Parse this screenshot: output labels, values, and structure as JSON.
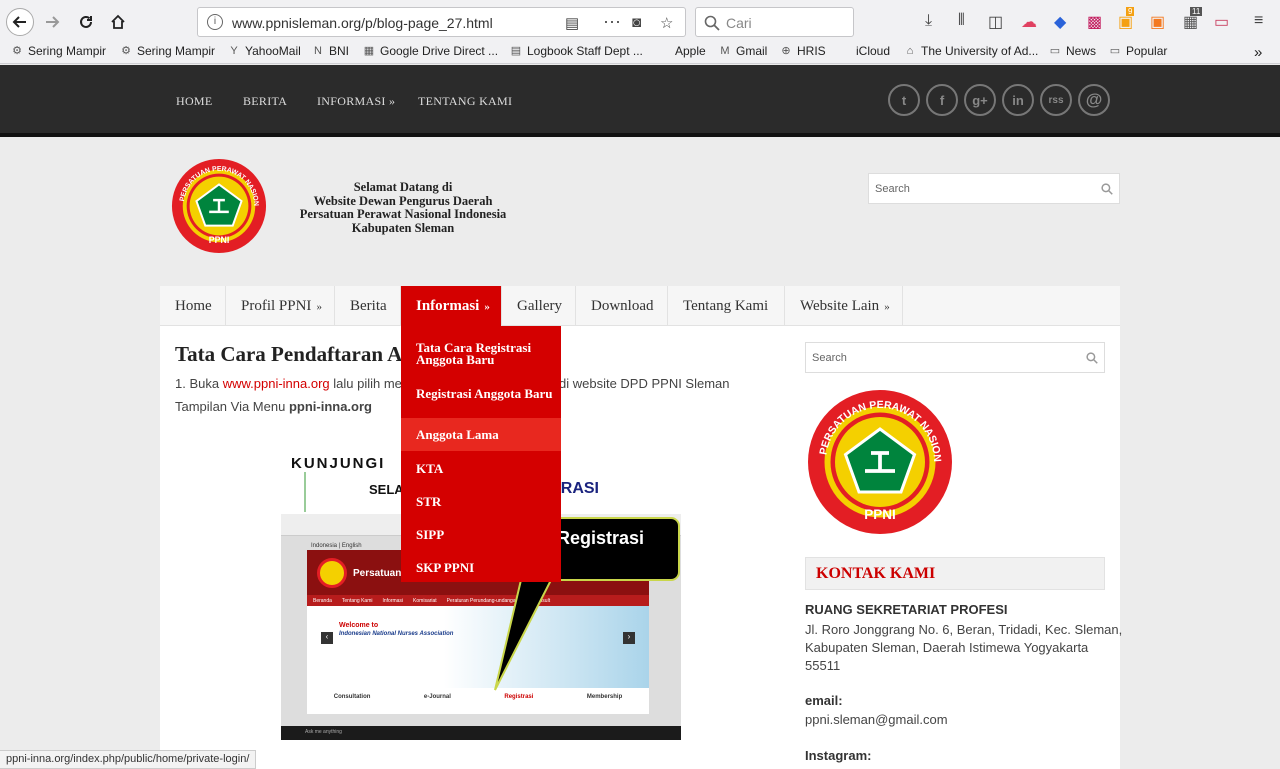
{
  "browser": {
    "url": "www.ppnisleman.org/p/blog-page_27.html",
    "search_placeholder": "Cari",
    "badge_count_1": "9",
    "badge_count_2": "11",
    "bookmarks": [
      "Sering Mampir",
      "Sering Mampir",
      "YahooMail",
      "BNI",
      "Google Drive Direct ...",
      "Logbook Staff Dept ...",
      "Apple",
      "Gmail",
      "HRIS",
      "iCloud",
      "The University of Ad...",
      "News",
      "Popular"
    ]
  },
  "topnav": {
    "items": [
      "HOME",
      "BERITA",
      "INFORMASI",
      "TENTANG KAMI"
    ],
    "arrow": "»"
  },
  "social": {
    "icons": [
      "twitter-icon",
      "facebook-icon",
      "googleplus-icon",
      "linkedin-icon",
      "rss-icon",
      "email-icon"
    ],
    "labels": [
      "t",
      "f",
      "g+",
      "in",
      "rss",
      "@"
    ]
  },
  "header": {
    "tagline": [
      "Selamat Datang di",
      "Website Dewan Pengurus Daerah",
      "Persatuan Perawat Nasional Indonesia",
      "Kabupaten Sleman"
    ],
    "search_placeholder": "Search",
    "logo_ring_text": "PERSATUAN PERAWAT NASIONAL INDONESIA",
    "logo_label": "PPNI"
  },
  "menu": {
    "items": [
      {
        "label": "Home",
        "arrow": ""
      },
      {
        "label": "Profil PPNI",
        "arrow": "»"
      },
      {
        "label": "Berita",
        "arrow": ""
      },
      {
        "label": "Informasi",
        "arrow": "»"
      },
      {
        "label": "Gallery",
        "arrow": ""
      },
      {
        "label": "Download",
        "arrow": ""
      },
      {
        "label": "Tentang Kami",
        "arrow": ""
      },
      {
        "label": "Website Lain",
        "arrow": "»"
      }
    ],
    "active_index": 3
  },
  "dropdown": {
    "items": [
      "Tata Cara Registrasi Anggota Baru",
      "Registrasi Anggota Baru",
      "Anggota Lama",
      "KTA",
      "STR",
      "SIPP",
      "SKP PPNI"
    ],
    "hover_index": 2
  },
  "post": {
    "title": "Tata Cara Pendaftaran A",
    "line1_pre": "1. Buka ",
    "line1_link": "www.ppni-inna.org",
    "line1_post": " lalu pilih men",
    "line1_tail": " di website DPD PPNI Sleman",
    "line2_pre": "Tampilan Via Menu ",
    "line2_bold": "ppni-inna.org"
  },
  "post_image": {
    "heading1": "KUNJUNGI",
    "heading2_pre": "SELA",
    "heading2_post": "TRASI",
    "callout": "Registrasi",
    "site_title": "Persatuan P",
    "languages": "Indonesia | English",
    "welcome": "Welcome to",
    "assoc": "Indonesian National Nurses Association",
    "nav": [
      "Beranda",
      "Tentang Kami",
      "Informasi",
      "Komisariat",
      "Peraturan Perundang-undangan",
      "E-Konsult"
    ],
    "tiles": [
      "Consultation",
      "e-Journal",
      "Registrasi",
      "Membership"
    ],
    "taskbar_search": "Ask me anything"
  },
  "sidebar": {
    "search_placeholder": "Search",
    "kontak_title": "KONTAK KAMI",
    "office": "RUANG SEKRETARIAT PROFESI",
    "address": [
      "Jl. Roro Jonggrang No. 6, Beran, Tridadi, Kec. Sleman,",
      "Kabupaten Sleman, Daerah Istimewa Yogyakarta",
      "55511"
    ],
    "email_label": "email:",
    "email": "ppni.sleman@gmail.com",
    "instagram_label": "Instagram:"
  },
  "status_url": "ppni-inna.org/index.php/public/home/private-login/",
  "colors": {
    "accent": "#d40000",
    "dark": "#2b2b2b",
    "logo_green": "#00843d",
    "logo_yellow": "#f4d000"
  }
}
